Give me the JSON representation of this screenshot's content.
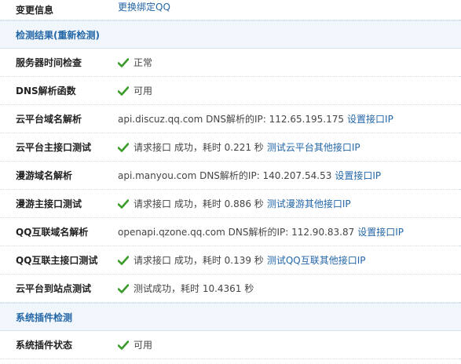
{
  "change_info": {
    "label": "变更信息",
    "link": "更换绑定QQ"
  },
  "section_detect": {
    "title": "检测结果(重新检测)"
  },
  "rows": [
    {
      "label": "服务器时间检查",
      "status": "正常"
    },
    {
      "label": "DNS解析函数",
      "status": "可用"
    },
    {
      "label": "云平台域名解析",
      "text": "api.discuz.qq.com DNS解析的IP: 112.65.195.175",
      "link": "设置接口IP"
    },
    {
      "label": "云平台主接口测试",
      "text": "请求接口 成功，耗时 0.221 秒",
      "link": "测试云平台其他接口IP"
    },
    {
      "label": "漫游域名解析",
      "text": "api.manyou.com DNS解析的IP: 140.207.54.53",
      "link": "设置接口IP"
    },
    {
      "label": "漫游主接口测试",
      "text": "请求接口 成功，耗时 0.886 秒",
      "link": "测试漫游其他接口IP"
    },
    {
      "label": "QQ互联域名解析",
      "text": "openapi.qzone.qq.com DNS解析的IP: 112.90.83.87",
      "link": "设置接口IP"
    },
    {
      "label": "QQ互联主接口测试",
      "text": "请求接口 成功，耗时 0.139 秒",
      "link": "测试QQ互联其他接口IP"
    },
    {
      "label": "云平台到站点测试",
      "text": "测试成功，耗时 10.4361 秒"
    }
  ],
  "section_plugins": {
    "title": "系统插件检测"
  },
  "plugin_row": {
    "label": "系统插件状态",
    "status": "可用"
  },
  "colors": {
    "check": "#3a9a2a",
    "link": "#2366a8",
    "section_bg": "#f0f6fb"
  },
  "icons": {
    "check": "check-icon"
  }
}
